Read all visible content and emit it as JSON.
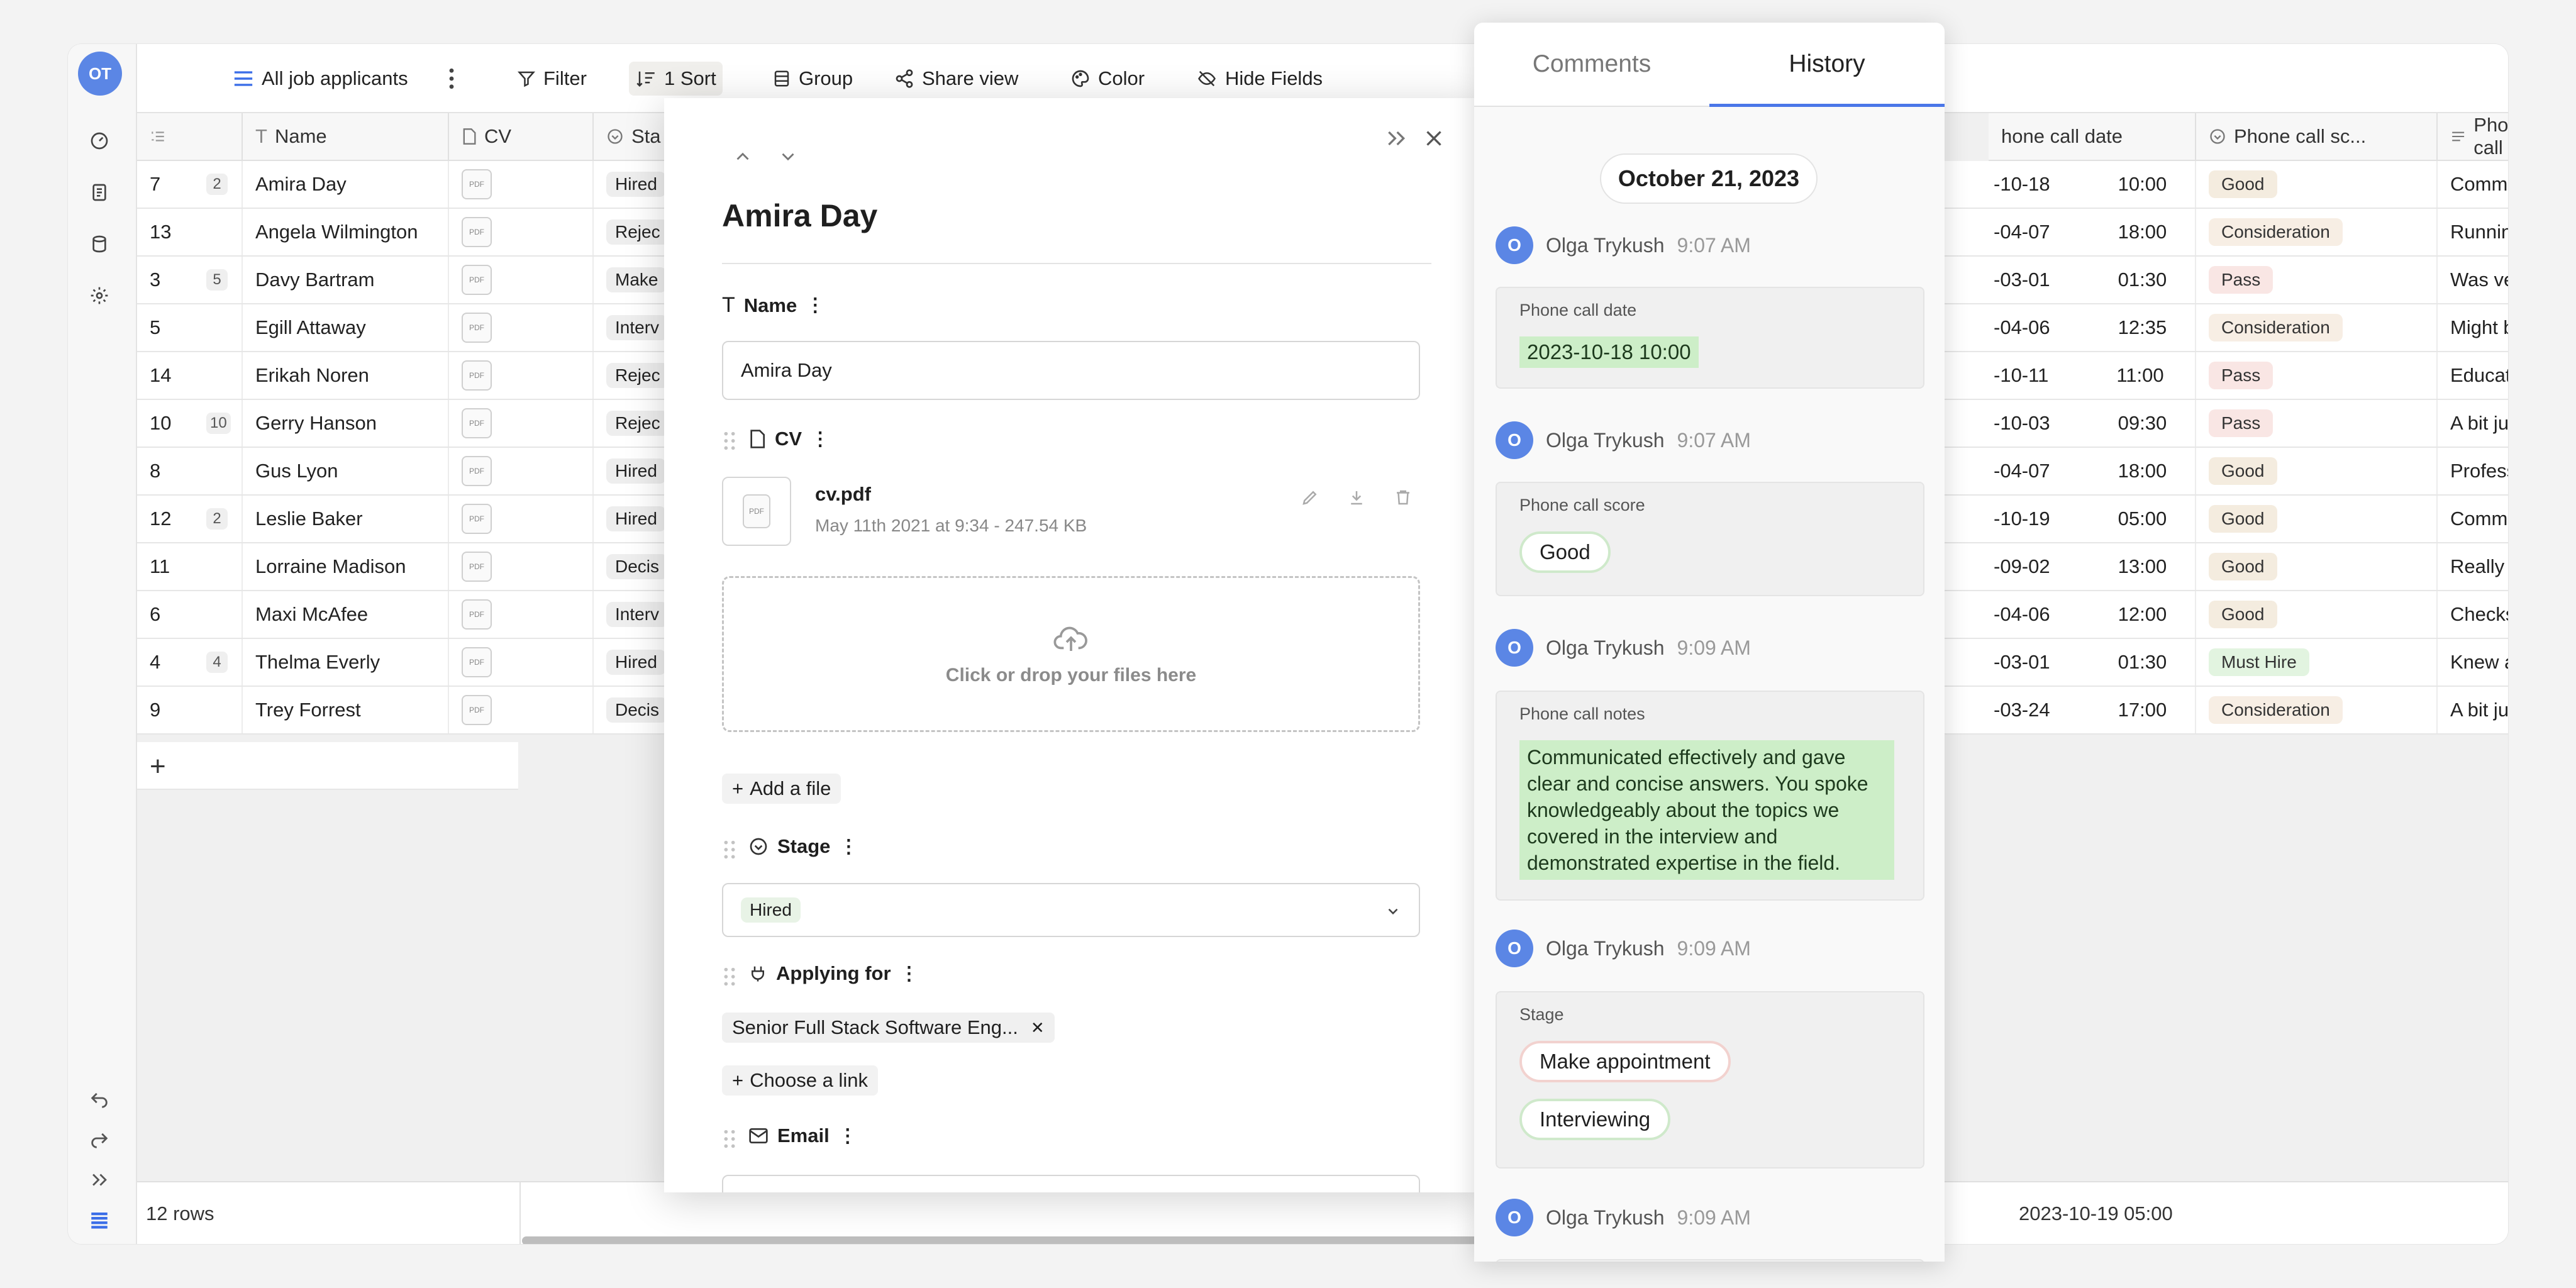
{
  "user": {
    "initials": "OT"
  },
  "toolbar": {
    "view_name": "All job applicants",
    "filter": "Filter",
    "sort": "1 Sort",
    "group": "Group",
    "share": "Share view",
    "color": "Color",
    "hide_fields": "Hide Fields"
  },
  "columns": {
    "name": "Name",
    "cv": "CV",
    "stage": "Sta",
    "phone_date": "hone call date",
    "phone_score": "Phone call sc...",
    "phone_notes": "Phone call"
  },
  "rows": [
    {
      "id": "7",
      "count": "2",
      "name": "Amira Day",
      "stage": "Hired",
      "date": "-10-18",
      "time": "10:00",
      "score": "Good",
      "score_cls": "p-good",
      "notes": "Communicate"
    },
    {
      "id": "13",
      "count": "",
      "name": "Angela Wilmington",
      "stage": "Rejec",
      "date": "-04-07",
      "time": "18:00",
      "score": "Consideration",
      "score_cls": "p-cons",
      "notes": "Running into s"
    },
    {
      "id": "3",
      "count": "5",
      "name": "Davy Bartram",
      "stage": "Make",
      "date": "-03-01",
      "time": "01:30",
      "score": "Pass",
      "score_cls": "p-pass",
      "notes": "Was very late"
    },
    {
      "id": "5",
      "count": "",
      "name": "Egill Attaway",
      "stage": "Interv",
      "date": "-04-06",
      "time": "12:35",
      "score": "Consideration",
      "score_cls": "p-cons",
      "notes": "Might be a bit"
    },
    {
      "id": "14",
      "count": "",
      "name": "Erikah Noren",
      "stage": "Rejec",
      "date": "-10-11",
      "time": "11:00",
      "score": "Pass",
      "score_cls": "p-pass",
      "notes": "Educational ba"
    },
    {
      "id": "10",
      "count": "10",
      "name": "Gerry Hanson",
      "stage": "Rejec",
      "date": "-10-03",
      "time": "09:30",
      "score": "Pass",
      "score_cls": "p-pass",
      "notes": "A bit junior for"
    },
    {
      "id": "8",
      "count": "",
      "name": "Gus Lyon",
      "stage": "Hired",
      "date": "-04-07",
      "time": "18:00",
      "score": "Good",
      "score_cls": "p-good",
      "notes": "Professional a"
    },
    {
      "id": "12",
      "count": "2",
      "name": "Leslie Baker",
      "stage": "Hired",
      "date": "-10-19",
      "time": "05:00",
      "score": "Good",
      "score_cls": "p-good",
      "notes": "Communicate"
    },
    {
      "id": "11",
      "count": "",
      "name": "Lorraine Madison",
      "stage": "Decis",
      "date": "-09-02",
      "time": "13:00",
      "score": "Good",
      "score_cls": "p-good",
      "notes": "Really great cu"
    },
    {
      "id": "6",
      "count": "",
      "name": "Maxi McAfee",
      "stage": "Interv",
      "date": "-04-06",
      "time": "12:00",
      "score": "Good",
      "score_cls": "p-good",
      "notes": "Checks all the"
    },
    {
      "id": "4",
      "count": "4",
      "name": "Thelma Everly",
      "stage": "Hired",
      "date": "-03-01",
      "time": "01:30",
      "score": "Must Hire",
      "score_cls": "p-must",
      "notes": "Knew a lot abo"
    },
    {
      "id": "9",
      "count": "",
      "name": "Trey Forrest",
      "stage": "Decis",
      "date": "-03-24",
      "time": "17:00",
      "score": "Consideration",
      "score_cls": "p-cons",
      "notes": "A bit junior for"
    }
  ],
  "footer": {
    "row_count": "12 rows",
    "summary": "2023-10-19 05:00"
  },
  "record": {
    "title": "Amira Day",
    "name_label": "Name",
    "name_value": "Amira Day",
    "cv_label": "CV",
    "file_name": "cv.pdf",
    "file_meta": "May 11th 2021 at 9:34 - 247.54 KB",
    "dropzone": "Click or drop your files here",
    "add_file": "Add a file",
    "stage_label": "Stage",
    "stage_value": "Hired",
    "applying_label": "Applying for",
    "applying_value": "Senior Full Stack Software Eng...",
    "choose_link": "Choose a link",
    "email_label": "Email"
  },
  "panel": {
    "tab_comments": "Comments",
    "tab_history": "History",
    "date": "October 21, 2023",
    "entries": [
      {
        "avatar": "O",
        "user": "Olga Trykush",
        "time": "9:07 AM",
        "field": "Phone call date",
        "value": "2023-10-18 10:00"
      },
      {
        "avatar": "O",
        "user": "Olga Trykush",
        "time": "9:07 AM",
        "field": "Phone call score",
        "value": "Good"
      },
      {
        "avatar": "O",
        "user": "Olga Trykush",
        "time": "9:09 AM",
        "field": "Phone call notes",
        "value": "Communicated effectively and gave clear and concise answers. You spoke knowledgeably about the topics we covered in the interview and demonstrated expertise in the field."
      },
      {
        "avatar": "O",
        "user": "Olga Trykush",
        "time": "9:09 AM",
        "field": "Stage",
        "old": "Make appointment",
        "new": "Interviewing"
      },
      {
        "avatar": "O",
        "user": "Olga Trykush",
        "time": "9:09 AM"
      }
    ]
  }
}
